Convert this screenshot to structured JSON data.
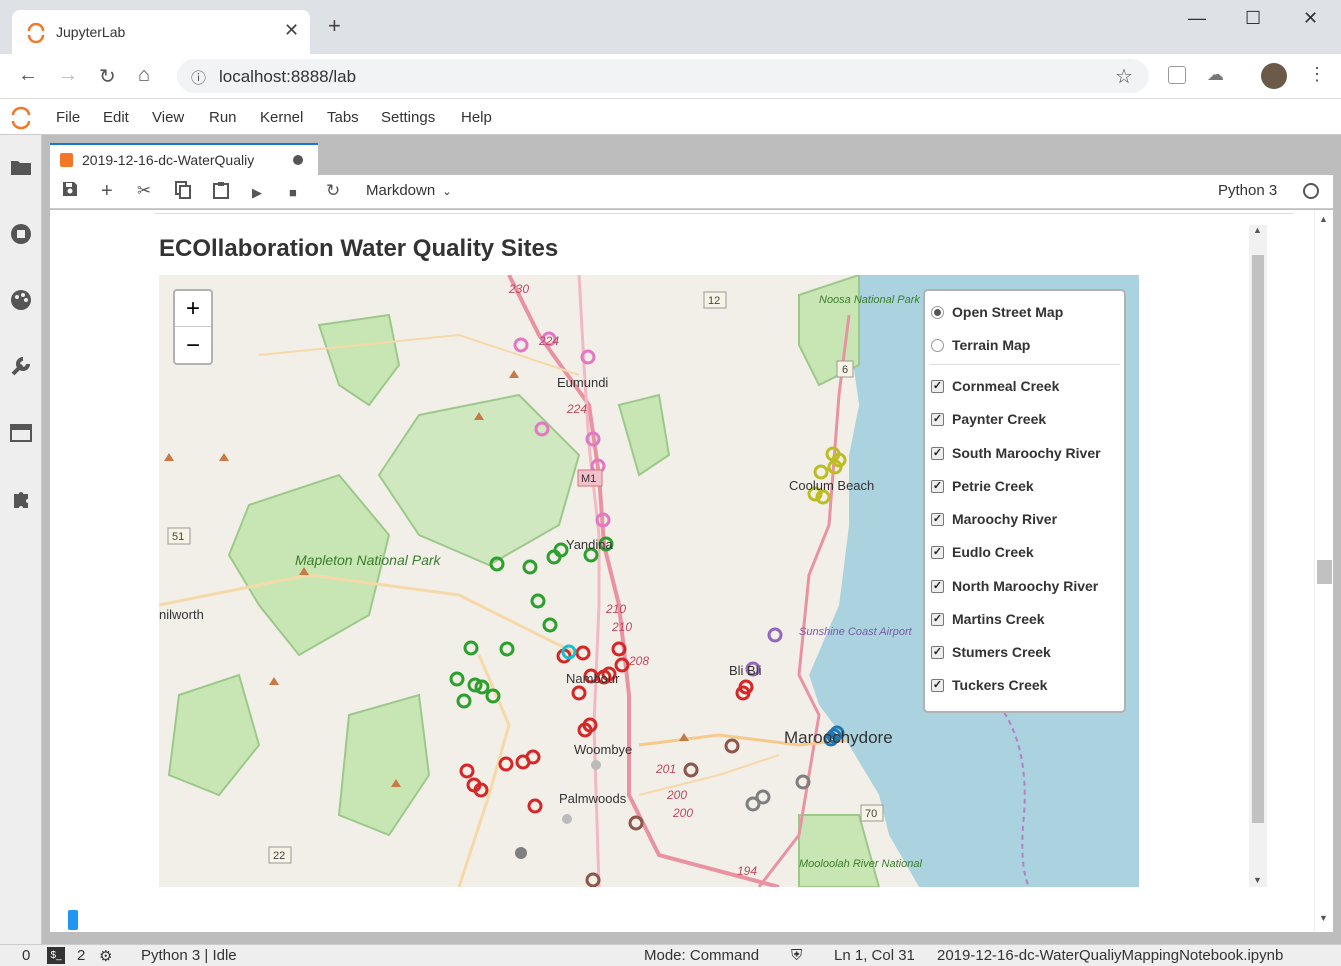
{
  "browser": {
    "tab_title": "JupyterLab",
    "new_tab_icon": "+",
    "url": "localhost:8888/lab",
    "window_controls": [
      "—",
      "☐",
      "✕"
    ]
  },
  "jupyter": {
    "menu": [
      "File",
      "Edit",
      "View",
      "Run",
      "Kernel",
      "Tabs",
      "Settings",
      "Help"
    ],
    "sidebar_icons": [
      "folder-icon",
      "stop-icon",
      "palette-icon",
      "wrench-icon",
      "tabs-icon",
      "extension-icon"
    ],
    "notebook_tab": "2019-12-16-dc-WaterQualiy",
    "toolbar": {
      "cell_type": "Markdown",
      "kernel": "Python 3"
    },
    "heading": "ECOllaboration Water Quality Sites"
  },
  "map": {
    "zoom_in": "+",
    "zoom_out": "−",
    "base_layers": [
      {
        "label": "Open Street Map",
        "selected": true
      },
      {
        "label": "Terrain Map",
        "selected": false
      }
    ],
    "overlays": [
      {
        "label": "Cornmeal Creek",
        "checked": true
      },
      {
        "label": "Paynter Creek",
        "checked": true
      },
      {
        "label": "South Maroochy River",
        "checked": true
      },
      {
        "label": "Petrie Creek",
        "checked": true
      },
      {
        "label": "Maroochy River",
        "checked": true
      },
      {
        "label": "Eudlo Creek",
        "checked": true
      },
      {
        "label": "North Maroochy River",
        "checked": true
      },
      {
        "label": "Martins Creek",
        "checked": true
      },
      {
        "label": "Stumers Creek",
        "checked": true
      },
      {
        "label": "Tuckers Creek",
        "checked": true
      }
    ],
    "places": [
      "Eumundi",
      "Yandina",
      "Nambour",
      "Woombye",
      "Palmwoods",
      "Bli Bli",
      "Maroochydore",
      "Coolum Beach",
      "Mapleton National Park",
      "Noosa National Park",
      "Sunshine Coast Airport",
      "Mooloolah River National",
      "nilworth"
    ],
    "road_labels": [
      "230",
      "224",
      "224",
      "M1",
      "12",
      "6",
      "51",
      "210",
      "210",
      "208",
      "201",
      "200",
      "200",
      "194",
      "70",
      "22"
    ],
    "colors": {
      "water": "#aad3df",
      "park": "#c8e6b4",
      "road": "#e8a0b0",
      "green": "#2ca02c",
      "red": "#d62728",
      "pink": "#e377c2",
      "olive": "#bcbd22",
      "grey": "#7f7f7f",
      "brown": "#8c564b",
      "purple": "#9467bd",
      "blue": "#1f77b4"
    }
  },
  "status": {
    "terminals": "0",
    "kernels": "2",
    "kernel_status": "Python 3 | Idle",
    "mode": "Mode: Command",
    "position": "Ln 1, Col 31",
    "filename": "2019-12-16-dc-WaterQualiyMappingNotebook.ipynb"
  }
}
